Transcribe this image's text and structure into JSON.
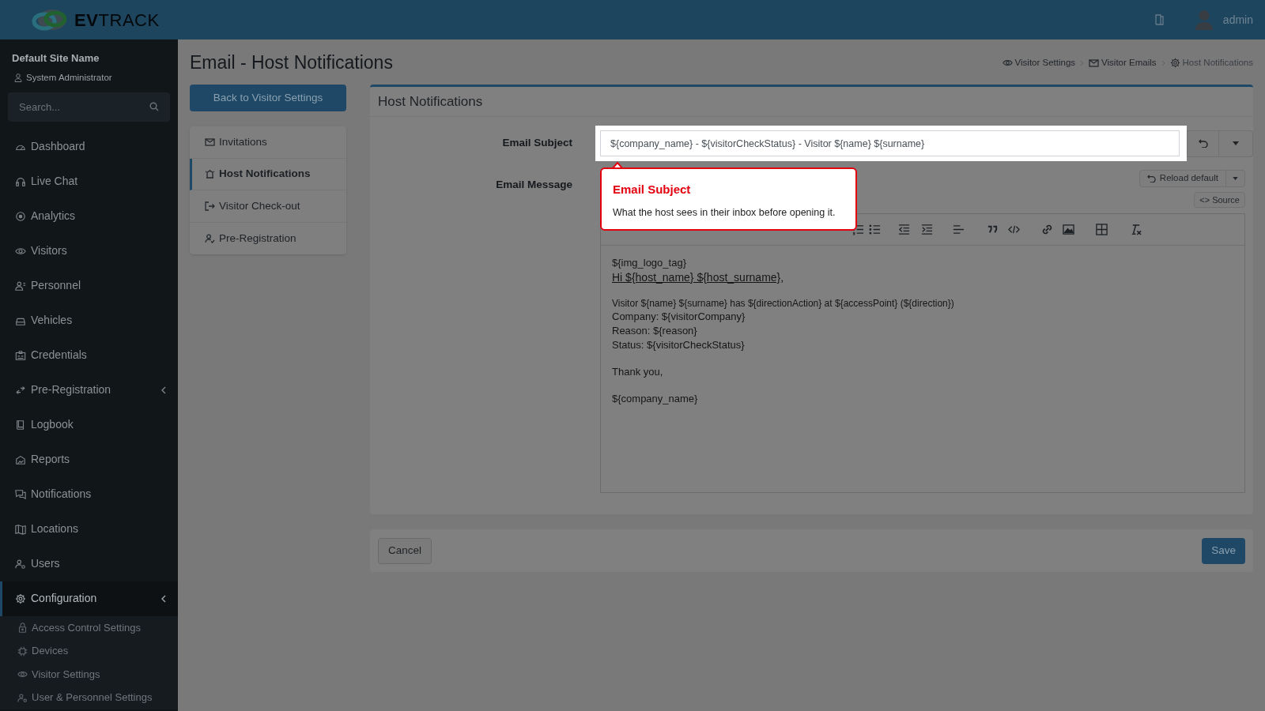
{
  "header": {
    "logo": "**EV**TRACK",
    "user": "admin"
  },
  "sidebar": {
    "site": "Default Site Name",
    "role": "System Administrator",
    "search": {
      "placeholder": "Search..."
    },
    "items": [
      {
        "label": "Dashboard",
        "expandable": false,
        "selected": false
      },
      {
        "label": "Live Chat",
        "expandable": false,
        "selected": false
      },
      {
        "label": "Analytics",
        "expandable": false,
        "selected": false
      },
      {
        "label": "Visitors",
        "expandable": false,
        "selected": false
      },
      {
        "label": "Personnel",
        "expandable": false,
        "selected": false
      },
      {
        "label": "Vehicles",
        "expandable": false,
        "selected": false
      },
      {
        "label": "Credentials",
        "expandable": false,
        "selected": false
      },
      {
        "label": "Pre-Registration",
        "expandable": true,
        "selected": false
      },
      {
        "label": "Logbook",
        "expandable": false,
        "selected": false
      },
      {
        "label": "Reports",
        "expandable": false,
        "selected": false
      },
      {
        "label": "Notifications",
        "expandable": false,
        "selected": false
      },
      {
        "label": "Locations",
        "expandable": false,
        "selected": false
      },
      {
        "label": "Users",
        "expandable": false,
        "selected": false
      },
      {
        "label": "Configuration",
        "expandable": true,
        "selected": true,
        "children": [
          {
            "label": "Access Control Settings"
          },
          {
            "label": "Devices"
          },
          {
            "label": "Visitor Settings"
          },
          {
            "label": "User & Personnel Settings"
          }
        ]
      }
    ]
  },
  "page": {
    "title": "Email - Host Notifications",
    "breadcrumbs": [
      "Visitor Settings",
      "Visitor Emails",
      "Host Notifications"
    ],
    "back_button": "Back to Visitor Settings",
    "tabs": [
      {
        "label": "Invitations",
        "selected": false
      },
      {
        "label": "Host Notifications",
        "selected": true
      },
      {
        "label": "Visitor Check-out",
        "selected": false
      },
      {
        "label": "Pre-Registration",
        "selected": false
      }
    ],
    "card": {
      "title": "Host Notifications",
      "subject": {
        "label": "Email Subject",
        "value": "${company_name} - ${visitorCheckStatus} - Visitor ${name} ${surname}"
      },
      "message": {
        "label": "Email Message",
        "reload_button": "Reload default",
        "source_button": "<> Source",
        "paragraphs": [
          [
            {
              "kind": "plain",
              "text": "${img_logo_tag}"
            },
            {
              "kind": "greeting",
              "text": "Hi ${host_name} ${host_surname}",
              "tail": ","
            }
          ],
          [
            {
              "kind": "small",
              "text": "Visitor ${name} ${surname} has ${directionAction} at ${accessPoint} (${direction})"
            },
            {
              "kind": "plain",
              "text": "Company: ${visitorCompany}"
            },
            {
              "kind": "plain",
              "text": "Reason: ${reason}"
            },
            {
              "kind": "plain",
              "text": "Status: ${visitorCheckStatus}"
            }
          ],
          [
            {
              "kind": "plain",
              "text": "Thank you,"
            }
          ],
          [
            {
              "kind": "plain",
              "text": "${company_name}"
            }
          ]
        ]
      }
    },
    "footer": {
      "cancel": "Cancel",
      "save": "Save"
    }
  },
  "tour": {
    "title": "Email Subject",
    "text": "What the host sees in their inbox before opening it."
  }
}
